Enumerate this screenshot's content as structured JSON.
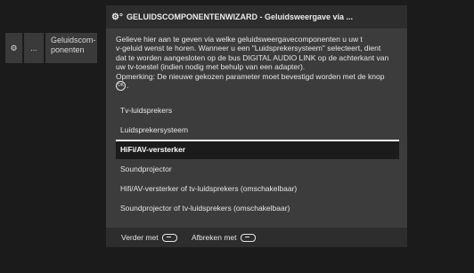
{
  "breadcrumb": {
    "item1_icon": "gear-icon",
    "item2_label": "...",
    "item3_label": "Geluidscom-\nponenten"
  },
  "dialog": {
    "header_icon": "sound-components-icon",
    "title": "GELUIDSCOMPONENTENWIZARD - Geluidsweergave via ...",
    "description_lines": [
      "Gelieve hier aan te geven via welke geluidsweergavecomponenten u uw t",
      "v-geluid wenst te horen. Wanneer u een \"Luidsprekersysteem\" selecteert, dient",
      "dat te worden aangesloten op de bus DIGITAL AUDIO LINK op de achterkant van",
      "uw tv-toestel (indien nodig met behulp van een adapter).",
      "Opmerking: De nieuwe gekozen parameter moet bevestigd worden met de knop"
    ],
    "ok_icon_text": "OK",
    "description_end": ".",
    "options": [
      {
        "label": "Tv-luidsprekers",
        "selected": false
      },
      {
        "label": "Luidsprekersysteem",
        "selected": false
      },
      {
        "label": "HiFi/AV-versterker",
        "selected": true
      },
      {
        "label": "Soundprojector",
        "selected": false
      },
      {
        "label": "Hifi/AV-versterker of tv-luidsprekers (omschakelbaar)",
        "selected": false
      },
      {
        "label": "Soundprojector of tv-luidsprekers (omschakelbaar)",
        "selected": false
      }
    ],
    "footer": {
      "next_label": "Verder met",
      "cancel_label": "Afbreken met"
    }
  }
}
